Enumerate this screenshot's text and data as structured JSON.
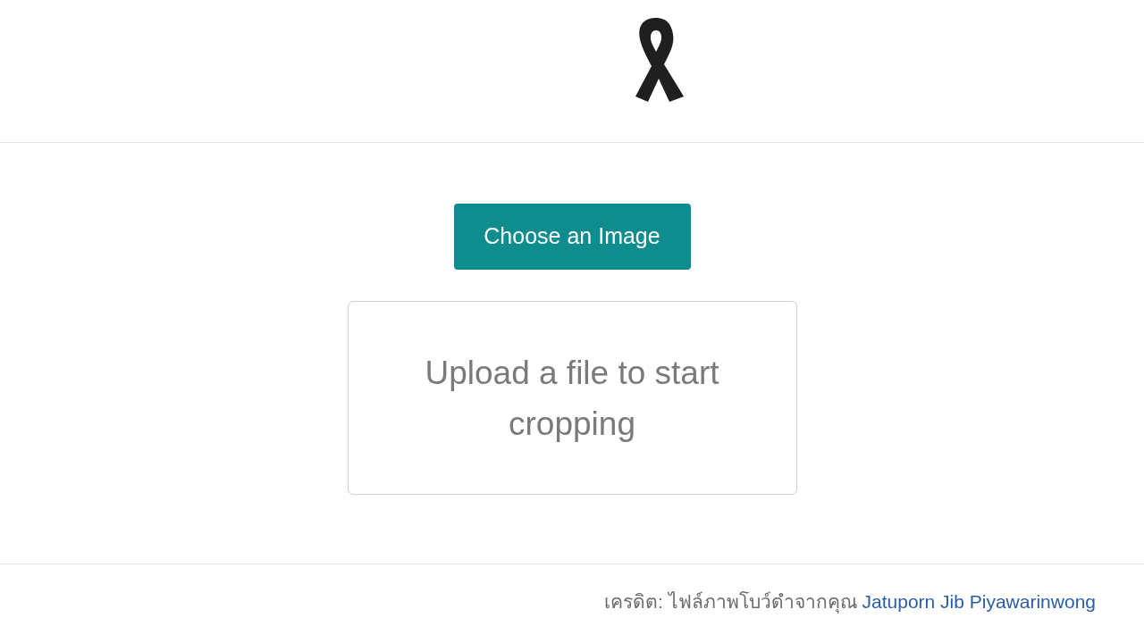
{
  "upload_button": {
    "label": "Choose an Image"
  },
  "crop_area": {
    "message": "Upload a file to start cropping"
  },
  "footer": {
    "credit": "เครดิต: ไฟล์ภาพโบว์ดำจากคุณ",
    "link": "Jatuporn Jib Piyawarinwong"
  }
}
